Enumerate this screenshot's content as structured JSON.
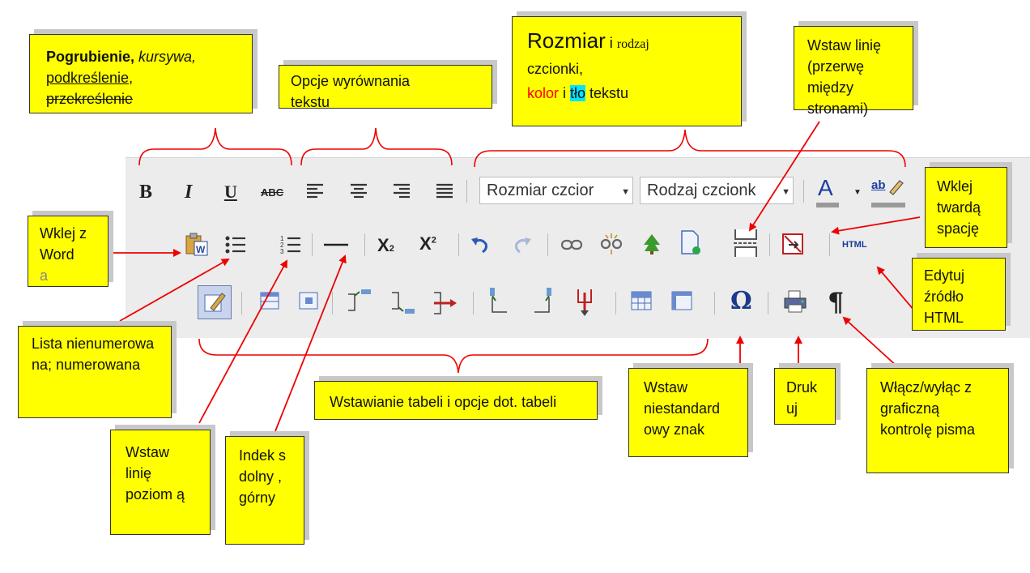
{
  "toolbar": {
    "row1": {
      "bold": "B",
      "italic": "I",
      "underline": "U",
      "strike": "ABC",
      "font_size_combo": "Rozmiar czcior",
      "font_family_combo": "Rodzaj czcionk",
      "font_color": "A",
      "highlight": "ab"
    },
    "row2": {
      "subscript": "X",
      "subscript_small": "2",
      "superscript": "X",
      "superscript_small": "2",
      "html": "HTML"
    },
    "row3": {
      "omega": "Ω",
      "pilcrow": "¶"
    }
  },
  "notes": {
    "format": {
      "bold": "Pogrubienie,",
      "italic": "kursywa,",
      "underline": "podkreślenie,",
      "strike": "przekreślenie"
    },
    "align": {
      "line1": "Opcje wyrównania",
      "line2": "tekstu"
    },
    "font": {
      "big": "Rozmiar",
      "i1": " i ",
      "small": "rodzaj",
      "line2": "czcionki,",
      "color": "kolor",
      "i2": "  i ",
      "bg": "tło",
      "rest": " tekstu"
    },
    "pagebreak": {
      "text": "Wstaw linię (przerwę między stronami)"
    },
    "nbsp": {
      "text": "Wklej twardą spację"
    },
    "word": {
      "text": "Wklej z Word",
      "extra": "a"
    },
    "html": {
      "text": "Edytuj źródło HTML"
    },
    "lists": {
      "text": "Lista nienumerowa na; numerowana"
    },
    "table": {
      "text": "Wstawianie tabeli i opcje dot. tabeli"
    },
    "hr": {
      "text": "Wstaw linię poziom ą"
    },
    "index": {
      "text": "Indek s dolny , górny"
    },
    "special": {
      "text": "Wstaw niestandard owy znak"
    },
    "print": {
      "text": "Druk uj"
    },
    "spell": {
      "text": "Włącz/wyłąc z graficzną kontrolę pisma"
    }
  },
  "colors": {
    "note_bg": "#ffff00",
    "arrow": "#ee0000",
    "brace": "#ee0000",
    "accent_red": "#ff0000",
    "accent_cyan": "#00e5ff"
  }
}
